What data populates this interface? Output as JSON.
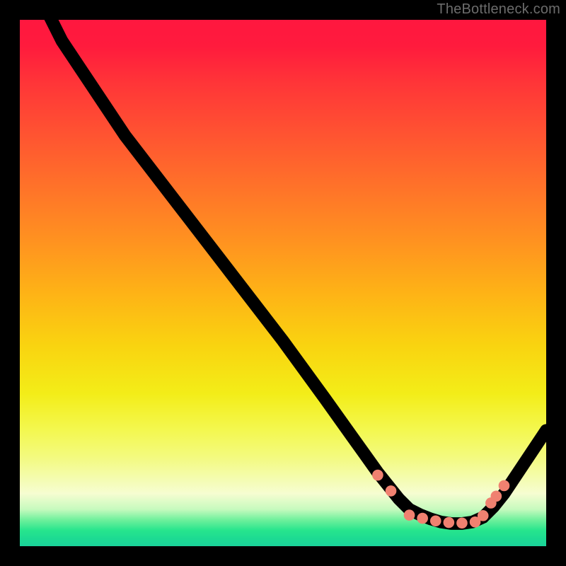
{
  "watermark": "TheBottleneck.com",
  "chart_data": {
    "type": "line",
    "title": "",
    "xlabel": "",
    "ylabel": "",
    "xlim": [
      0,
      100
    ],
    "ylim": [
      0,
      100
    ],
    "grid": false,
    "series": [
      {
        "name": "curve",
        "x": [
          5,
          8,
          12,
          20,
          30,
          40,
          50,
          58,
          63,
          68,
          72,
          74,
          76,
          78,
          80,
          82,
          84,
          86,
          88,
          90,
          92,
          100
        ],
        "y": [
          102,
          96,
          90,
          78,
          65,
          52,
          39,
          28,
          21,
          14,
          9,
          7,
          6,
          5.2,
          4.6,
          4.3,
          4.3,
          4.6,
          5.5,
          7.5,
          10,
          22
        ]
      }
    ],
    "markers": {
      "name": "dots",
      "x": [
        68,
        70.5,
        74,
        76.5,
        79,
        81.5,
        84,
        86.5,
        88,
        89.5,
        90.5,
        92
      ],
      "y": [
        13.5,
        10.5,
        5.9,
        5.3,
        4.8,
        4.5,
        4.4,
        4.6,
        5.8,
        8.2,
        9.5,
        11.5
      ]
    },
    "background_gradient": {
      "top": "#ff173f",
      "mid": "#f9d410",
      "bottom": "#1ad39a"
    }
  }
}
